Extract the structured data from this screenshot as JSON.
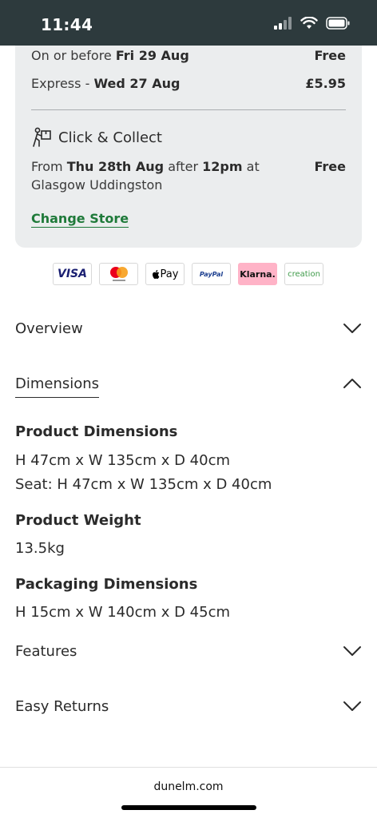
{
  "status": {
    "time": "11:44"
  },
  "delivery": {
    "standard": {
      "prefix": "On or before",
      "date": "Fri 29 Aug",
      "price": "Free"
    },
    "express": {
      "prefix": "Express -",
      "date": "Wed 27 Aug",
      "price": "£5.95"
    },
    "click_collect": {
      "title": "Click & Collect",
      "from": "From",
      "date": "Thu 28th Aug",
      "after": "after",
      "time": "12pm",
      "at_store": "at Glasgow Uddingston",
      "price": "Free",
      "change_store": "Change Store"
    }
  },
  "payments": [
    "VISA",
    "mastercard",
    "Pay",
    "PayPal",
    "Klarna.",
    "creation"
  ],
  "accordion": {
    "overview": "Overview",
    "dimensions": "Dimensions",
    "features": "Features",
    "easy_returns": "Easy Returns"
  },
  "dimensions": {
    "product_title": "Product Dimensions",
    "product_line1": "H 47cm x W 135cm x D 40cm",
    "product_line2": "Seat: H 47cm x W 135cm x D 40cm",
    "weight_title": "Product Weight",
    "weight_value": "13.5kg",
    "packaging_title": "Packaging Dimensions",
    "packaging_value": "H 15cm x W 140cm x D 45cm"
  },
  "browser": {
    "url": "dunelm.com"
  }
}
